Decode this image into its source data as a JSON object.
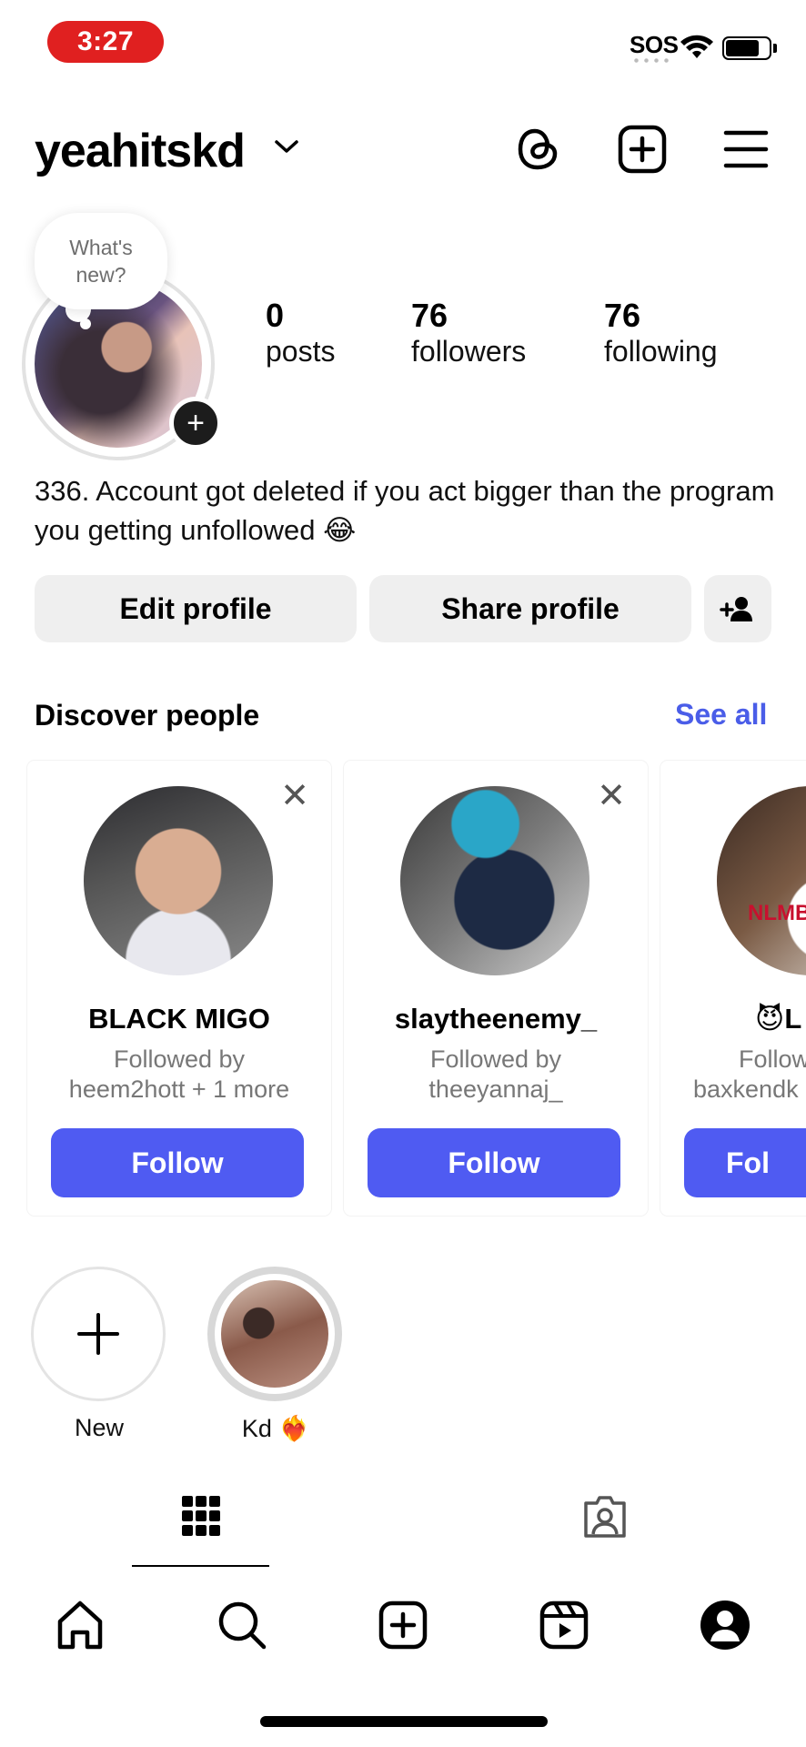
{
  "status_bar": {
    "time": "3:27",
    "sos": "SOS"
  },
  "header": {
    "username": "yeahitskd"
  },
  "profile": {
    "note_placeholder": "What's new?",
    "stats": [
      {
        "value": "0",
        "label": "posts"
      },
      {
        "value": "76",
        "label": "followers"
      },
      {
        "value": "76",
        "label": "following"
      }
    ],
    "bio": "336. Account got deleted if you act bigger than the program you getting unfollowed 😂",
    "buttons": {
      "edit": "Edit profile",
      "share": "Share profile"
    }
  },
  "discover": {
    "title": "Discover people",
    "see_all": "See all",
    "cards": [
      {
        "name": "BLACK MIGO",
        "line1": "Followed by",
        "line2": "heem2hott + 1 more",
        "follow": "Follow"
      },
      {
        "name": "slaytheenemy_",
        "line1": "Followed by",
        "line2": "theeyannaj_",
        "follow": "Follow"
      },
      {
        "name": "😈L",
        "line1": "Follow",
        "line2": "baxkendk",
        "follow": "Fol",
        "badge_text": "NLMB"
      }
    ]
  },
  "highlights": [
    {
      "label": "New"
    },
    {
      "label": "Kd ❤️‍🔥"
    }
  ],
  "colors": {
    "accent": "#4f5bf2",
    "link": "#4a5de8",
    "status_pill": "#e02020"
  }
}
